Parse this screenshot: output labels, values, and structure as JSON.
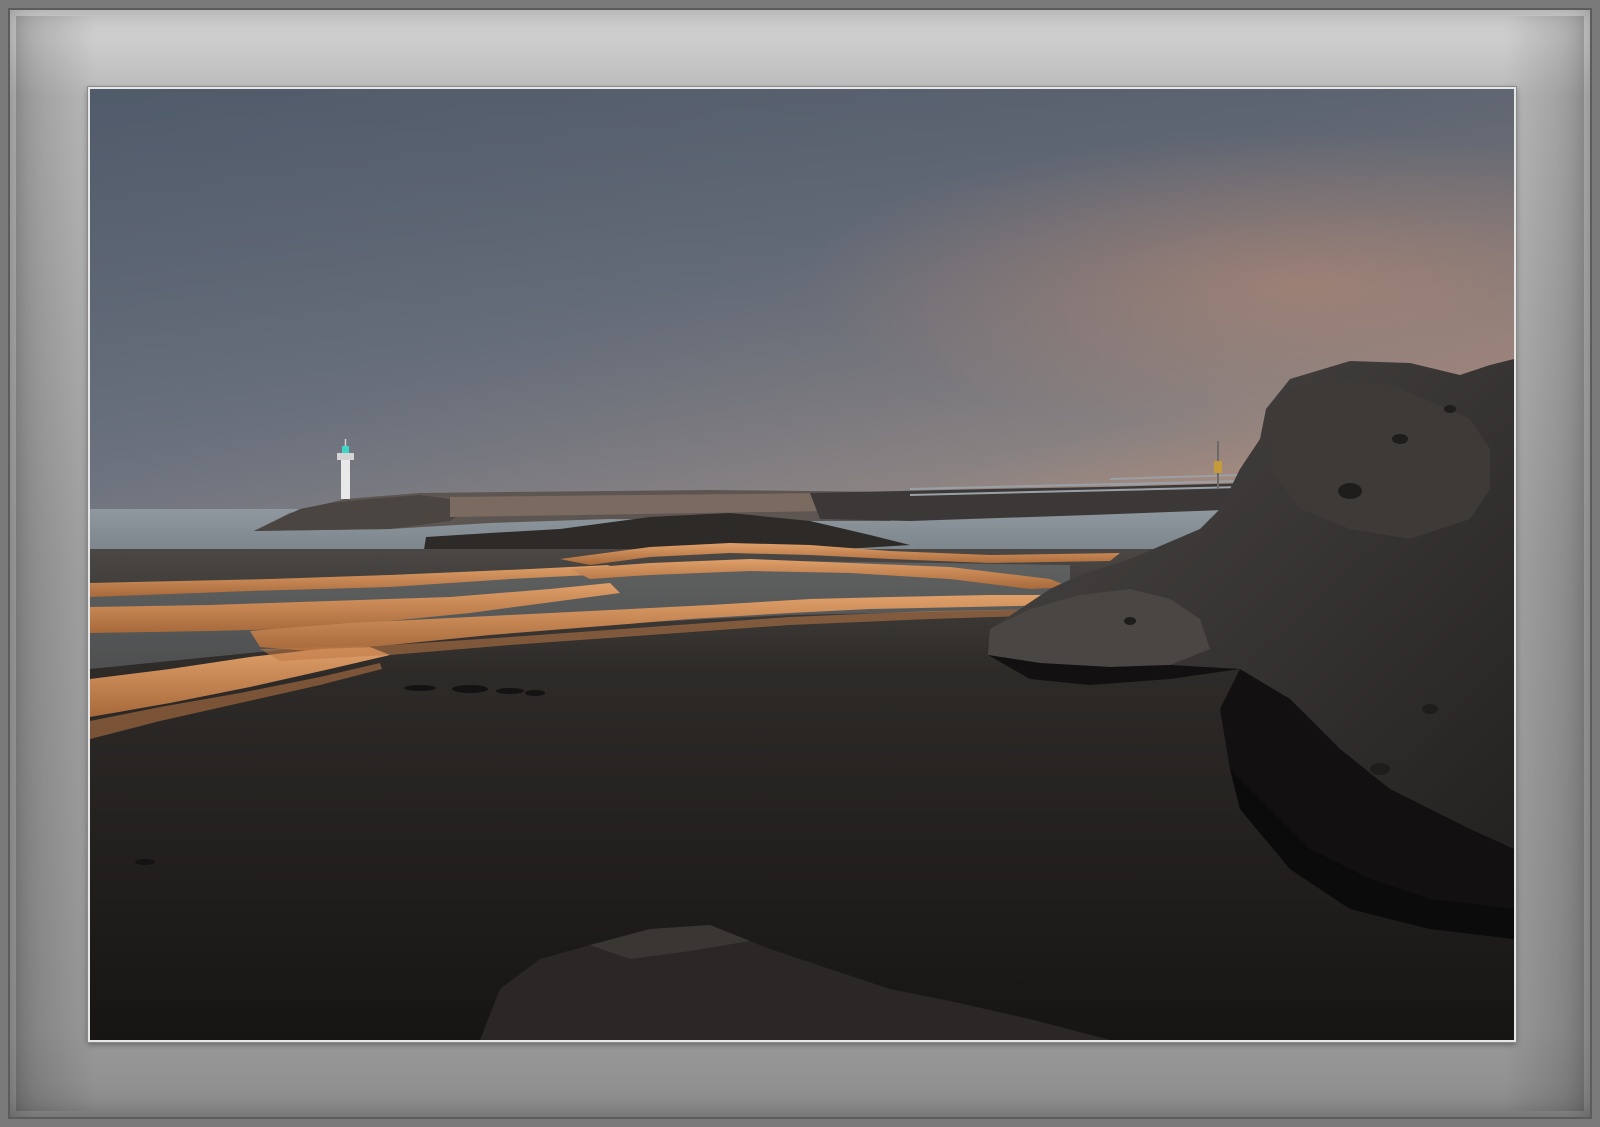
{
  "scene": {
    "subject": "coastal-tidepool-at-dusk",
    "colors": {
      "frame_light": "#d9d9d9",
      "frame_mid": "#a4a4a4",
      "sky_top": "#5f6a78",
      "sky_horizon": "#c9967a",
      "sea": "#8b969c",
      "water_dark": "#1e1b1a",
      "ridge_glow": "#c98a52",
      "rock": "#2e2c2b",
      "lighthouse": "#e8e8e8",
      "lighthouse_light": "#3fd6c8"
    },
    "elements": [
      "photo-frame",
      "sky",
      "distant-sea",
      "breakwater",
      "lighthouse",
      "railing",
      "glowing-rock-ridges",
      "tidepool-water",
      "volcanic-rock-right",
      "rock-foreground",
      "rock-reflection"
    ]
  }
}
